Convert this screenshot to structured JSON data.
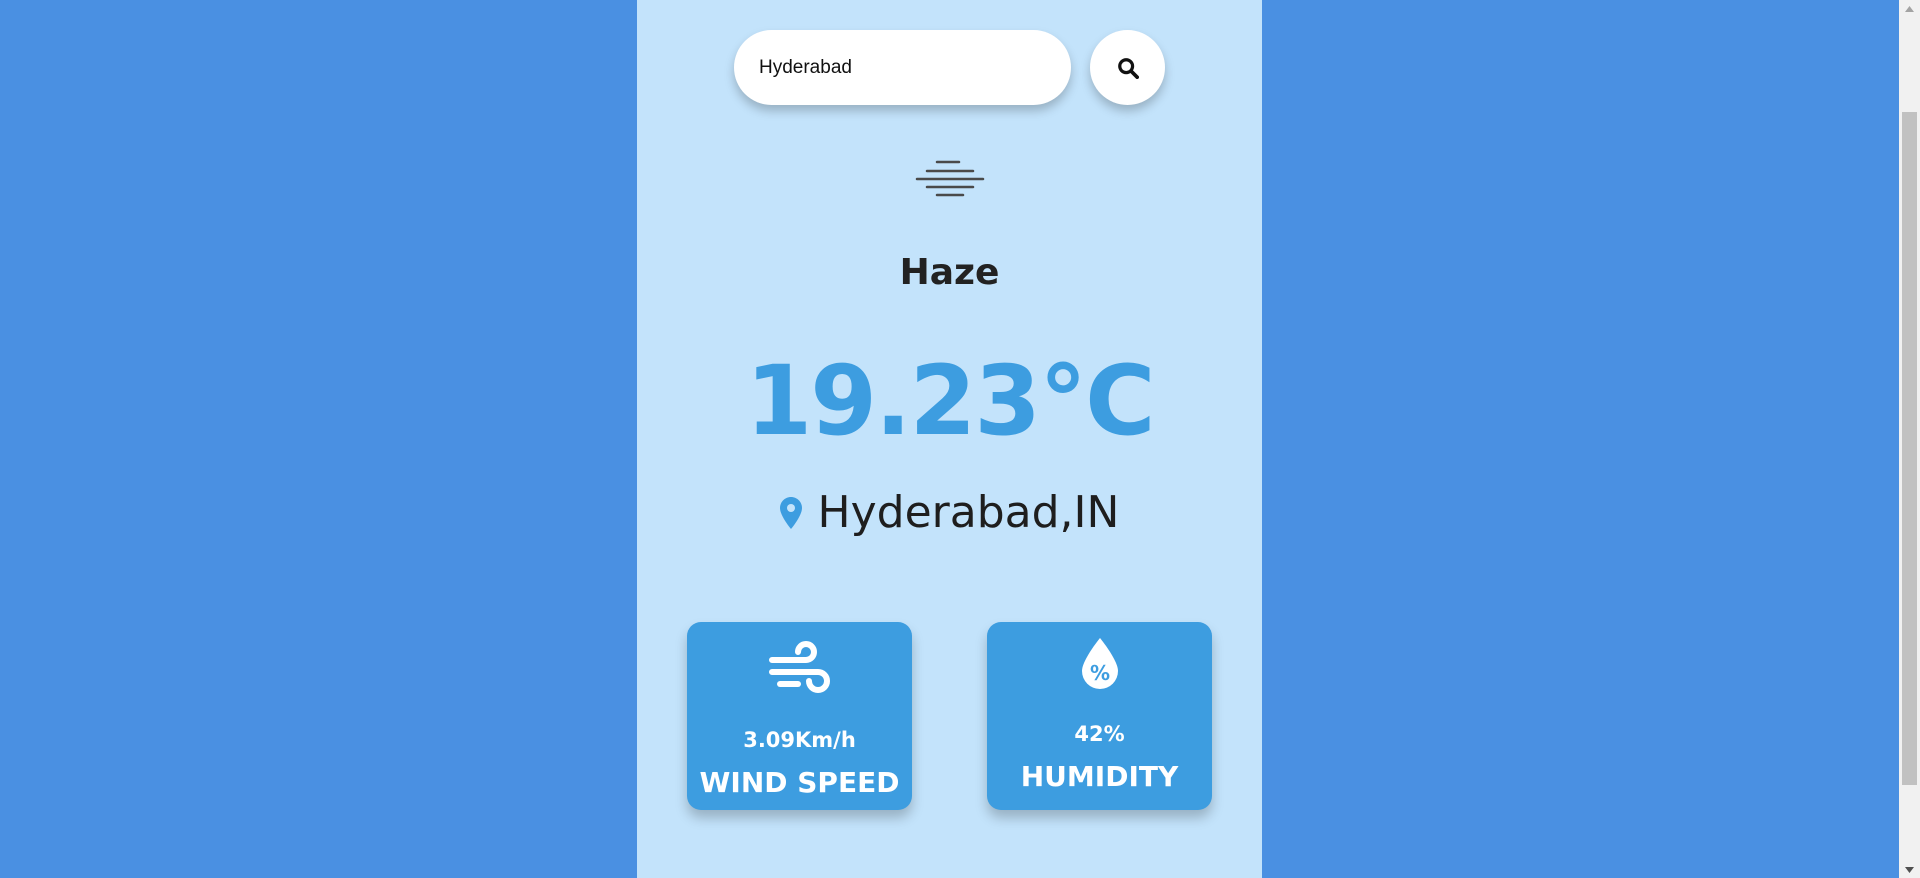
{
  "search": {
    "value": "Hyderabad",
    "placeholder": ""
  },
  "weather": {
    "condition": "Haze",
    "icon": "haze-icon",
    "temperature": "19.23°C",
    "location": "Hyderabad,IN"
  },
  "stats": {
    "wind": {
      "value": "3.09Km/h",
      "label": "WIND SPEED",
      "icon": "wind-icon"
    },
    "humidity": {
      "value": "42%",
      "label": "HUMIDITY",
      "icon": "humidity-icon"
    }
  },
  "colors": {
    "background": "#4a90e2",
    "card": "#c3e3fb",
    "accent": "#3d9de0",
    "text": "#222222"
  }
}
